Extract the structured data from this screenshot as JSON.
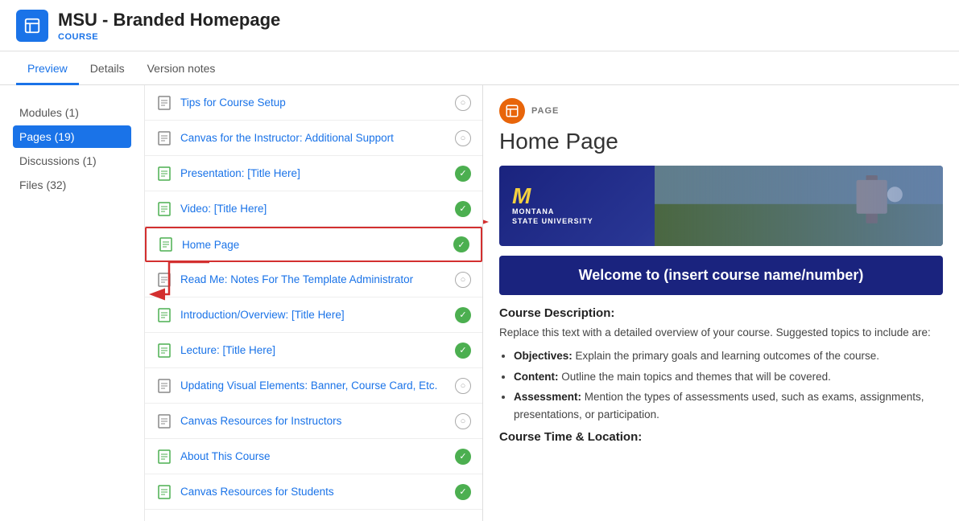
{
  "header": {
    "title": "MSU - Branded Homepage",
    "subtitle": "COURSE",
    "icon_alt": "course-icon"
  },
  "tabs": [
    {
      "label": "Preview",
      "active": true
    },
    {
      "label": "Details",
      "active": false
    },
    {
      "label": "Version notes",
      "active": false
    }
  ],
  "sidebar": {
    "items": [
      {
        "label": "Modules (1)",
        "active": false
      },
      {
        "label": "Pages (19)",
        "active": true
      },
      {
        "label": "Discussions (1)",
        "active": false
      },
      {
        "label": "Files (32)",
        "active": false
      }
    ]
  },
  "pages_list": {
    "items": [
      {
        "title": "Tips for Course Setup",
        "status": "gray",
        "highlighted": false,
        "icon": "doc-empty"
      },
      {
        "title": "Canvas for the Instructor: Additional Support",
        "status": "gray",
        "highlighted": false,
        "icon": "doc-empty"
      },
      {
        "title": "Presentation: [Title Here]",
        "status": "green",
        "highlighted": false,
        "icon": "doc-full"
      },
      {
        "title": "Video: [Title Here]",
        "status": "green",
        "highlighted": false,
        "icon": "doc-full"
      },
      {
        "title": "Home Page",
        "status": "green",
        "highlighted": true,
        "icon": "doc-full"
      },
      {
        "title": "Read Me: Notes For The Template Administrator",
        "status": "gray",
        "highlighted": false,
        "icon": "doc-empty"
      },
      {
        "title": "Introduction/Overview: [Title Here]",
        "status": "green",
        "highlighted": false,
        "icon": "doc-full"
      },
      {
        "title": "Lecture: [Title Here]",
        "status": "green",
        "highlighted": false,
        "icon": "doc-full"
      },
      {
        "title": "Updating Visual Elements: Banner, Course Card, Etc.",
        "status": "gray",
        "highlighted": false,
        "icon": "doc-empty"
      },
      {
        "title": "Canvas Resources for Instructors",
        "status": "gray",
        "highlighted": false,
        "icon": "doc-empty"
      },
      {
        "title": "About This Course",
        "status": "green",
        "highlighted": false,
        "icon": "doc-full"
      },
      {
        "title": "Canvas Resources for Students",
        "status": "green",
        "highlighted": false,
        "icon": "doc-full"
      }
    ]
  },
  "preview": {
    "label": "PAGE",
    "title": "Home Page",
    "university_name": "MONTANA\nSTATE UNIVERSITY",
    "welcome_text": "Welcome to (insert course name/number)",
    "course_description_heading": "Course Description:",
    "course_description_intro": "Replace this text with a detailed overview of your course. Suggested topics to include are:",
    "bullet_items": [
      {
        "bold": "Objectives:",
        "text": " Explain the primary goals and learning outcomes of the course."
      },
      {
        "bold": "Content:",
        "text": " Outline the main topics and themes that will be covered."
      },
      {
        "bold": "Assessment:",
        "text": " Mention the types of assessments used, such as exams, assignments, presentations, or participation."
      }
    ],
    "course_time_heading": "Course Time & Location:"
  }
}
